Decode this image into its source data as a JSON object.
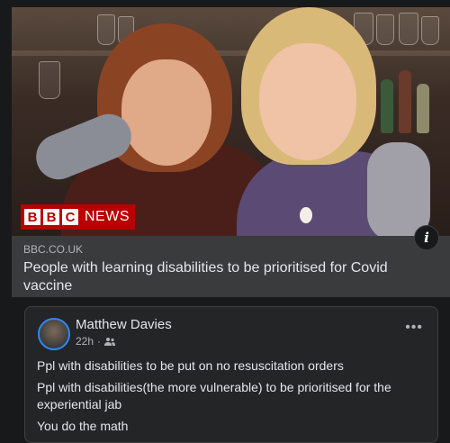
{
  "link_preview": {
    "badge": {
      "letters": [
        "B",
        "B",
        "C"
      ],
      "word": "NEWS",
      "color": "#b80000"
    },
    "info_icon_glyph": "i",
    "domain": "BBC.CO.UK",
    "title": "People with learning disabilities to be prioritised for Covid vaccine"
  },
  "post": {
    "author": "Matthew Davies",
    "time": "22h",
    "audience_icon": "friends-icon",
    "more_glyph": "•••",
    "lines": [
      "Ppl with disabilities to be put on no resuscitation orders",
      "Ppl with disabilities(the more vulnerable) to be prioritised for the experiential jab",
      "You do the math"
    ]
  },
  "colors": {
    "background": "#18191a",
    "card": "#242526",
    "accent": "#2d88ff"
  }
}
